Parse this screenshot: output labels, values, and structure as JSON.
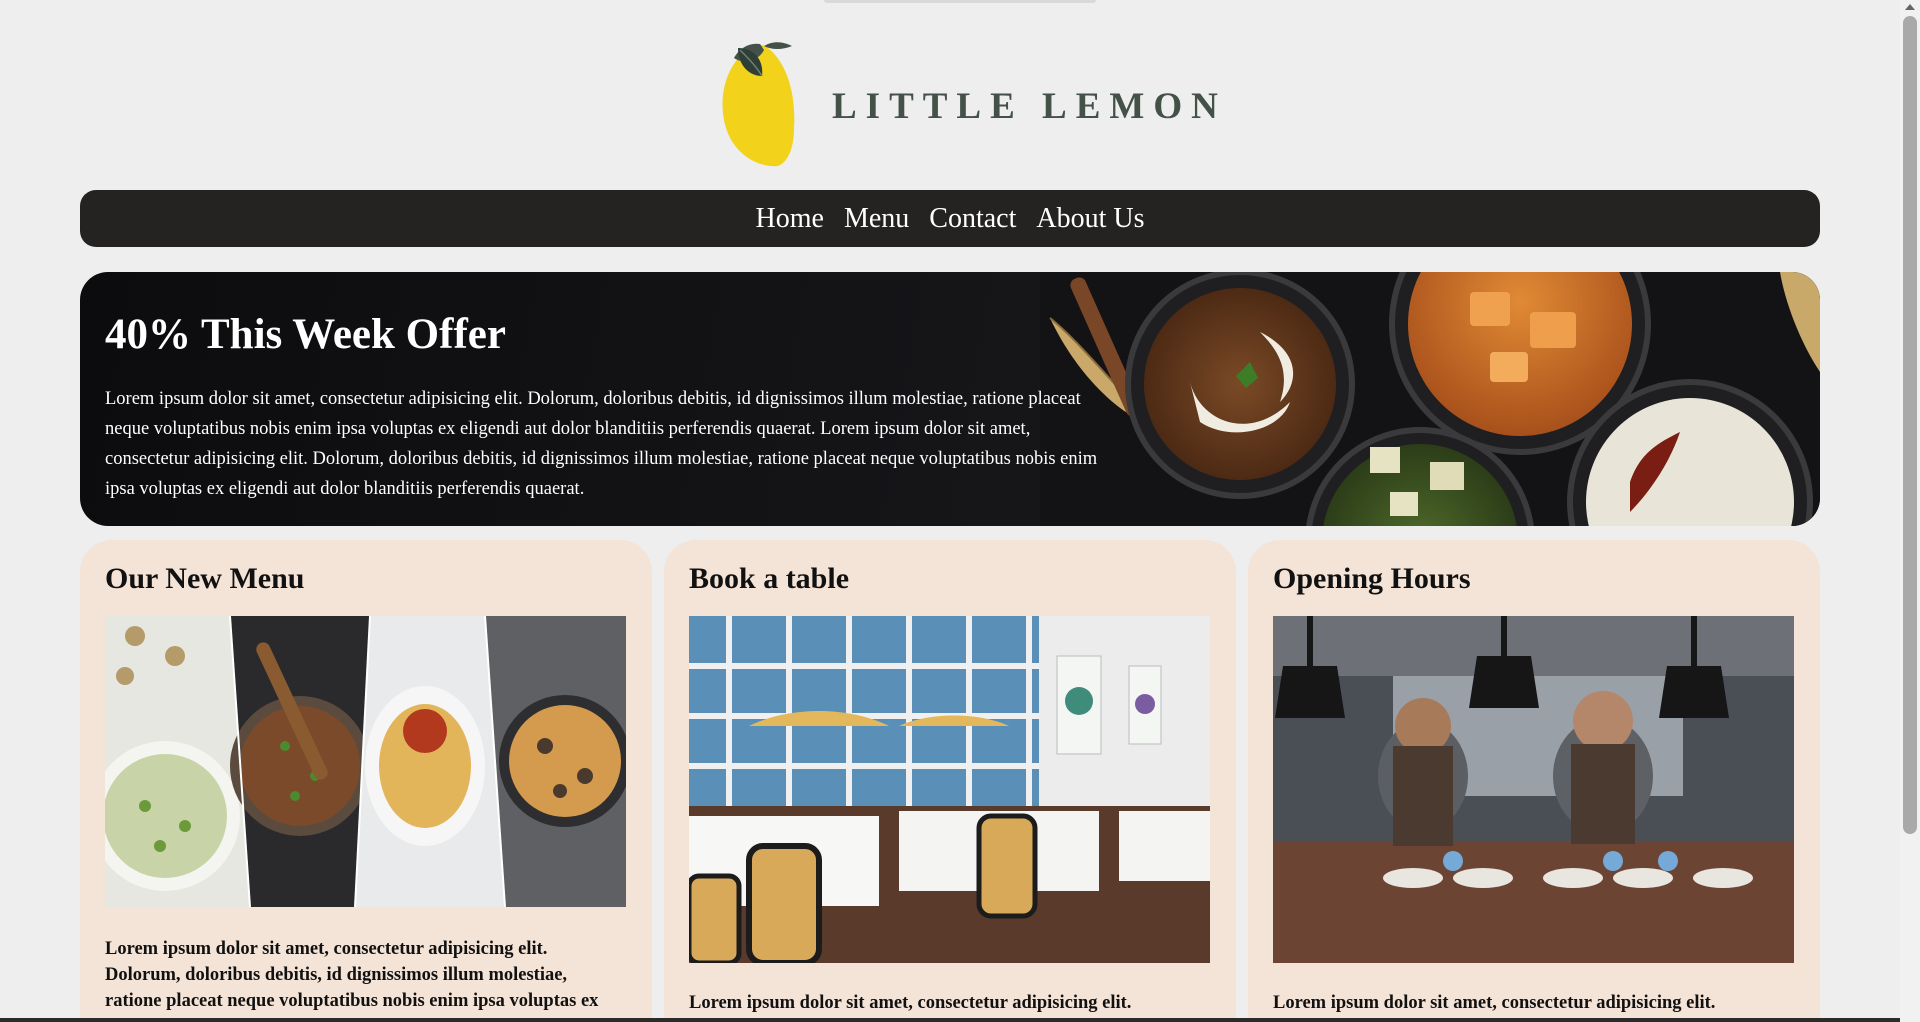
{
  "brand": {
    "name": "LITTLE LEMON"
  },
  "nav": {
    "items": [
      "Home",
      "Menu",
      "Contact",
      "About Us"
    ]
  },
  "hero": {
    "title": "40% This Week Offer",
    "text": "Lorem ipsum dolor sit amet, consectetur adipisicing elit. Dolorum, doloribus debitis, id dignissimos illum molestiae, ratione placeat neque voluptatibus nobis enim ipsa voluptas ex eligendi aut dolor blanditiis perferendis quaerat. Lorem ipsum dolor sit amet, consectetur adipisicing elit. Dolorum, doloribus debitis, id dignissimos illum molestiae, ratione placeat neque voluptatibus nobis enim ipsa voluptas ex eligendi aut dolor blanditiis perferendis quaerat."
  },
  "cards": [
    {
      "title": "Our New Menu",
      "text": "Lorem ipsum dolor sit amet, consectetur adipisicing elit. Dolorum, doloribus debitis, id dignissimos illum molestiae, ratione placeat neque voluptatibus nobis enim ipsa voluptas ex eligendi aut dolor blanditiis perferendis quaerat."
    },
    {
      "title": "Book a table",
      "text": "Lorem ipsum dolor sit amet, consectetur adipisicing elit."
    },
    {
      "title": "Opening Hours",
      "text": "Lorem ipsum dolor sit amet, consectetur adipisicing elit."
    }
  ],
  "colors": {
    "background": "#edeeed",
    "nav": "#252322",
    "card": "#f4e3d7",
    "lemon": "#f2d21b",
    "brand_text": "#435149"
  },
  "icons": [
    "lemon-logo-icon"
  ]
}
